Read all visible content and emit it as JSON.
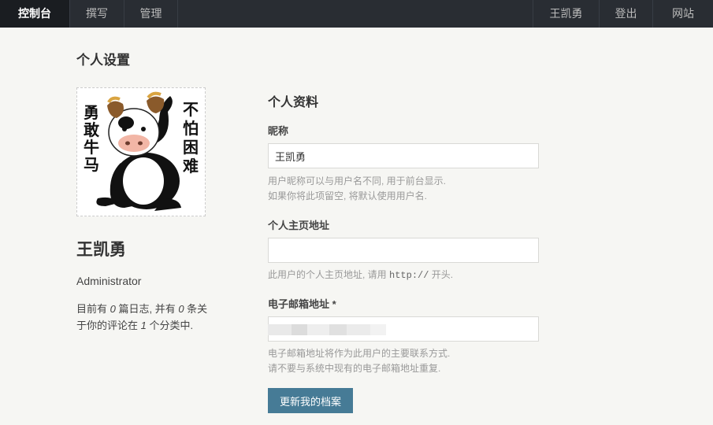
{
  "nav": {
    "left": [
      {
        "label": "控制台",
        "active": true
      },
      {
        "label": "撰写",
        "active": false
      },
      {
        "label": "管理",
        "active": false
      }
    ],
    "right": [
      {
        "label": "王凯勇"
      },
      {
        "label": "登出"
      },
      {
        "label": "网站"
      }
    ]
  },
  "page": {
    "title": "个人设置"
  },
  "profile": {
    "avatar_text_left": "勇敢牛马",
    "avatar_text_right": "不怕困难",
    "name": "王凯勇",
    "role": "Administrator",
    "stats": {
      "prefix": "目前有 ",
      "posts": "0",
      "mid1": " 篇日志, 并有 ",
      "comments": "0",
      "mid2": " 条关于你的评论在 ",
      "categories": "1",
      "suffix": " 个分类中."
    }
  },
  "form": {
    "section_title": "个人资料",
    "nickname": {
      "label": "昵称",
      "value": "王凯勇",
      "hint1": "用户昵称可以与用户名不同, 用于前台显示.",
      "hint2": "如果你将此项留空, 将默认使用用户名."
    },
    "homepage": {
      "label": "个人主页地址",
      "value": "",
      "hint_prefix": "此用户的个人主页地址, 请用 ",
      "hint_code": "http://",
      "hint_suffix": " 开头."
    },
    "email": {
      "label": "电子邮箱地址 *",
      "value": "",
      "hint1": "电子邮箱地址将作为此用户的主要联系方式.",
      "hint2": "请不要与系统中现有的电子邮箱地址重复."
    },
    "submit_label": "更新我的档案"
  },
  "colors": {
    "nav_bg": "#292d33",
    "nav_active_bg": "#1a1d21",
    "page_bg": "#f6f6f3",
    "button_bg": "#467b96"
  }
}
